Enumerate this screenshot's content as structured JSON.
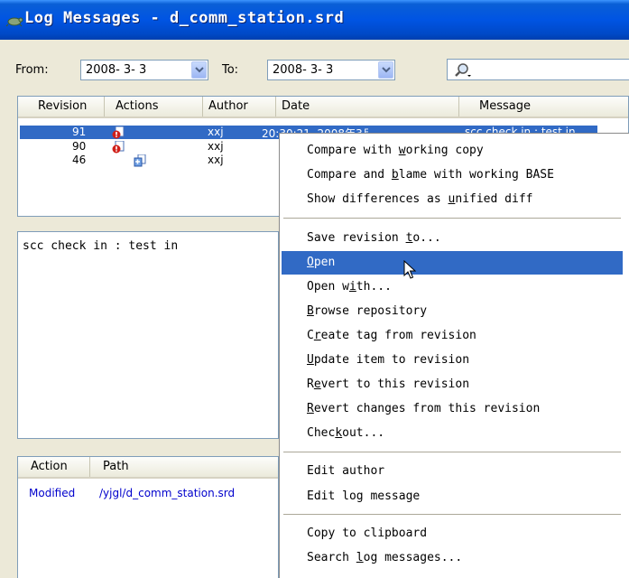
{
  "window": {
    "title": "Log Messages - d_comm_station.srd",
    "icon": "tortoise-icon"
  },
  "filters": {
    "from_label": "From:",
    "from_value": "2008- 3- 3",
    "to_label": "To:",
    "to_value": "2008- 3- 3",
    "search_icon": "search-icon"
  },
  "log_table": {
    "columns": [
      "Revision",
      "Actions",
      "Author",
      "Date",
      "Message"
    ],
    "rows": [
      {
        "revision": "91",
        "author": "xxj",
        "date": "20:30:21, 2008年3月3日",
        "message": "scc check in : test in",
        "selected": true
      },
      {
        "revision": "90",
        "author": "xxj",
        "date": "",
        "message": ""
      },
      {
        "revision": "46",
        "author": "xxj",
        "date": "",
        "message": ""
      }
    ]
  },
  "message_text": "scc check in : test in",
  "paths_table": {
    "columns": [
      "Action",
      "Path"
    ],
    "rows": [
      {
        "action": "Modified",
        "path": "/yjgl/d_comm_station.srd"
      }
    ]
  },
  "context_menu": {
    "items": [
      {
        "pre": "Compare with ",
        "u": "w",
        "post": "orking copy"
      },
      {
        "pre": "Compare and ",
        "u": "b",
        "post": "lame with working BASE"
      },
      {
        "pre": "Show differences as ",
        "u": "u",
        "post": "nified diff"
      },
      {
        "pre": "Save revision ",
        "u": "t",
        "post": "o..."
      },
      {
        "pre": "",
        "u": "O",
        "post": "pen"
      },
      {
        "pre": "Open w",
        "u": "i",
        "post": "th..."
      },
      {
        "pre": "",
        "u": "B",
        "post": "rowse repository"
      },
      {
        "pre": "C",
        "u": "r",
        "post": "eate tag from revision"
      },
      {
        "pre": "",
        "u": "U",
        "post": "pdate item to revision"
      },
      {
        "pre": "R",
        "u": "e",
        "post": "vert to this revision"
      },
      {
        "pre": "",
        "u": "R",
        "post": "evert changes from this revision"
      },
      {
        "pre": "Chec",
        "u": "k",
        "post": "out..."
      },
      {
        "pre": "Edit a",
        "u": "",
        "post": "uthor"
      },
      {
        "pre": "Edit log message",
        "u": "",
        "post": ""
      },
      {
        "pre": "Copy to clipboard",
        "u": "",
        "post": ""
      },
      {
        "pre": "Search ",
        "u": "l",
        "post": "og messages..."
      }
    ],
    "highlighted": "Open"
  }
}
